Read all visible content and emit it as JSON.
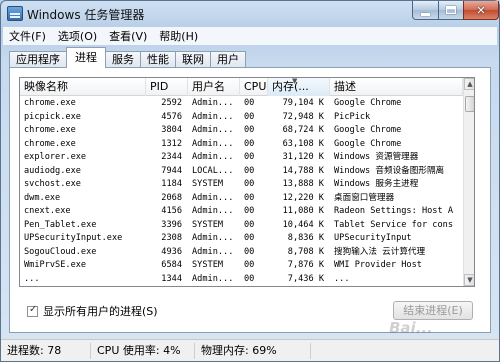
{
  "window": {
    "title": "Windows 任务管理器"
  },
  "menu": [
    "文件(F)",
    "选项(O)",
    "查看(V)",
    "帮助(H)"
  ],
  "tabs": [
    "应用程序",
    "进程",
    "服务",
    "性能",
    "联网",
    "用户"
  ],
  "active_tab": "进程",
  "columns": {
    "name": "映像名称",
    "pid": "PID",
    "user": "用户名",
    "cpu": "CPU",
    "mem": "内存(...",
    "desc": "描述"
  },
  "processes": [
    {
      "name": "chrome.exe",
      "pid": "2592",
      "user": "Admin...",
      "cpu": "00",
      "mem": "79,104 K",
      "desc": "Google Chrome"
    },
    {
      "name": "picpick.exe",
      "pid": "4576",
      "user": "Admin...",
      "cpu": "00",
      "mem": "72,948 K",
      "desc": "PicPick"
    },
    {
      "name": "chrome.exe",
      "pid": "3804",
      "user": "Admin...",
      "cpu": "00",
      "mem": "68,724 K",
      "desc": "Google Chrome"
    },
    {
      "name": "chrome.exe",
      "pid": "1312",
      "user": "Admin...",
      "cpu": "00",
      "mem": "63,108 K",
      "desc": "Google Chrome"
    },
    {
      "name": "explorer.exe",
      "pid": "2344",
      "user": "Admin...",
      "cpu": "00",
      "mem": "31,120 K",
      "desc": "Windows 资源管理器"
    },
    {
      "name": "audiodg.exe",
      "pid": "7944",
      "user": "LOCAL...",
      "cpu": "00",
      "mem": "14,788 K",
      "desc": "Windows 音频设备图形隔离"
    },
    {
      "name": "svchost.exe",
      "pid": "1184",
      "user": "SYSTEM",
      "cpu": "00",
      "mem": "13,888 K",
      "desc": "Windows 服务主进程"
    },
    {
      "name": "dwm.exe",
      "pid": "2068",
      "user": "Admin...",
      "cpu": "00",
      "mem": "12,220 K",
      "desc": "桌面窗口管理器"
    },
    {
      "name": "cnext.exe",
      "pid": "4156",
      "user": "Admin...",
      "cpu": "00",
      "mem": "11,080 K",
      "desc": "Radeon Settings: Host A"
    },
    {
      "name": "Pen_Tablet.exe",
      "pid": "3396",
      "user": "SYSTEM",
      "cpu": "00",
      "mem": "10,464 K",
      "desc": "Tablet Service for cons"
    },
    {
      "name": "UPSecurityInput.exe",
      "pid": "2308",
      "user": "Admin...",
      "cpu": "00",
      "mem": "8,836 K",
      "desc": "UPSecurityInput"
    },
    {
      "name": "SogouCloud.exe",
      "pid": "4936",
      "user": "Admin...",
      "cpu": "00",
      "mem": "8,708 K",
      "desc": "搜狗输入法 云计算代理"
    },
    {
      "name": "WmiPrvSE.exe",
      "pid": "6584",
      "user": "SYSTEM",
      "cpu": "00",
      "mem": "7,876 K",
      "desc": "WMI Provider Host"
    },
    {
      "name": "...",
      "pid": "1344",
      "user": "Admin...",
      "cpu": "00",
      "mem": "7,436 K",
      "desc": "..."
    }
  ],
  "show_all_users": {
    "label": "显示所有用户的进程(S)",
    "checked": true
  },
  "end_process_button": "结束进程(E)",
  "status": {
    "processes": "进程数: 78",
    "cpu": "CPU 使用率: 4%",
    "memory": "物理内存: 69%"
  },
  "watermark": "Bai..."
}
